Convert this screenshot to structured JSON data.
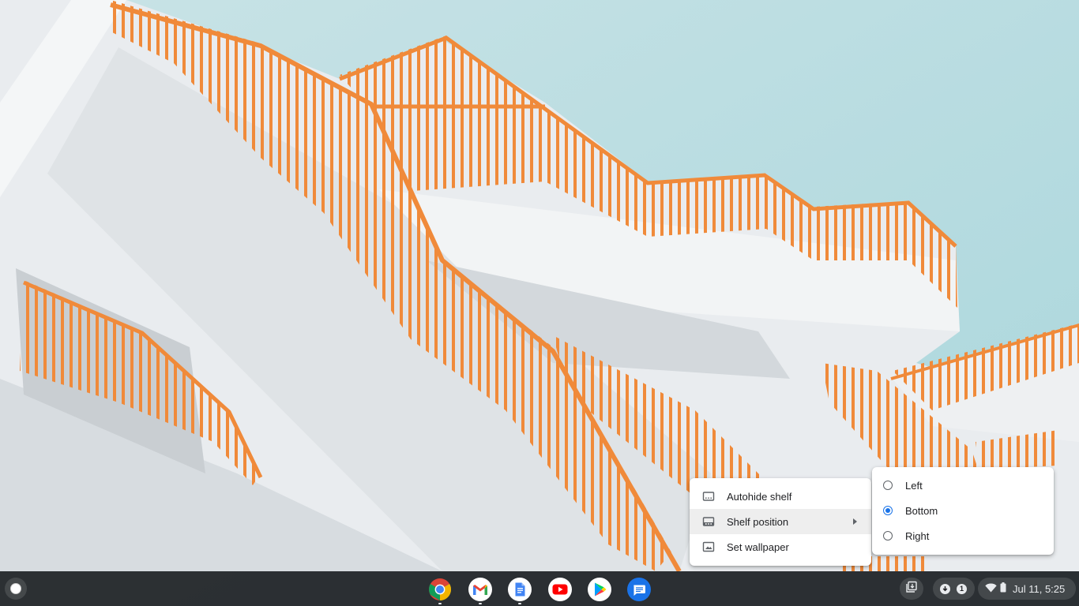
{
  "context_menu": {
    "items": [
      {
        "label": "Autohide shelf",
        "icon": "autohide-shelf-icon"
      },
      {
        "label": "Shelf position",
        "icon": "shelf-position-icon",
        "has_submenu": true,
        "highlighted": true
      },
      {
        "label": "Set wallpaper",
        "icon": "wallpaper-icon"
      }
    ]
  },
  "shelf_position_submenu": {
    "options": [
      {
        "label": "Left",
        "selected": false
      },
      {
        "label": "Bottom",
        "selected": true
      },
      {
        "label": "Right",
        "selected": false
      }
    ]
  },
  "shelf": {
    "apps": [
      {
        "name": "Chrome",
        "icon": "chrome-icon",
        "running": true
      },
      {
        "name": "Gmail",
        "icon": "gmail-icon",
        "running": true
      },
      {
        "name": "Docs",
        "icon": "docs-icon",
        "running": true
      },
      {
        "name": "YouTube",
        "icon": "youtube-icon",
        "running": false
      },
      {
        "name": "Play Store",
        "icon": "play-store-icon",
        "running": false
      },
      {
        "name": "Messages",
        "icon": "messages-icon",
        "running": false
      }
    ]
  },
  "status_area": {
    "notification_count": "1",
    "time": "Jul 11, 5:25"
  },
  "colors": {
    "accent": "#1a73e8",
    "shelf_bg": "#202124",
    "railing_orange": "#f08a3a",
    "sky": "#b9dde2"
  }
}
